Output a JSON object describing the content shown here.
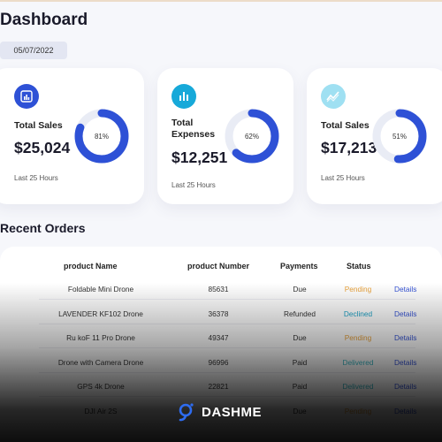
{
  "header": {
    "title": "Dashboard",
    "date": "05/07/2022"
  },
  "cards": [
    {
      "label": "Total Sales",
      "value": "$25,024",
      "percent_label": "81%",
      "percent": 81,
      "sub": "Last 25 Hours",
      "icon": "bar-chart-icon",
      "icon_bg": "#2e51d6"
    },
    {
      "label_line1": "Total",
      "label_line2": "Expenses",
      "value": "$12,251",
      "percent_label": "62%",
      "percent": 62,
      "sub": "Last 25 Hours",
      "icon": "stats-icon",
      "icon_bg": "#17a9d9"
    },
    {
      "label": "Total Sales",
      "value": "$17,213",
      "percent_label": "51%",
      "percent": 51,
      "sub": "Last 25 Hours",
      "icon": "trend-icon",
      "icon_bg": "#9fe0f2"
    }
  ],
  "orders": {
    "title": "Recent Orders",
    "columns": {
      "name": "product Name",
      "number": "product Number",
      "payments": "Payments",
      "status": "Status"
    },
    "rows": [
      {
        "name": "Foldable Mini Drone",
        "number": "85631",
        "payment": "Due",
        "status": "Pending",
        "action": "Details"
      },
      {
        "name": "LAVENDER KF102 Drone",
        "number": "36378",
        "payment": "Refunded",
        "status": "Declined",
        "action": "Details"
      },
      {
        "name": "Ru koF 11 Pro Drone",
        "number": "49347",
        "payment": "Due",
        "status": "Pending",
        "action": "Details"
      },
      {
        "name": "Drone with Camera Drone",
        "number": "96996",
        "payment": "Paid",
        "status": "Delivered",
        "action": "Details"
      },
      {
        "name": "GPS 4k Drone",
        "number": "22821",
        "payment": "Paid",
        "status": "Delivered",
        "action": "Details"
      },
      {
        "name": "DJI Air 2S",
        "number": "",
        "payment": "Due",
        "status": "Pending",
        "action": "Details"
      }
    ]
  },
  "brand": {
    "name": "DASHME"
  },
  "colors": {
    "accent": "#2e51d6",
    "track": "#e9ecf5",
    "pending": "#e9a23b",
    "declined": "#1da3c7",
    "delivered": "#39b8c4",
    "details": "#3553d6"
  }
}
